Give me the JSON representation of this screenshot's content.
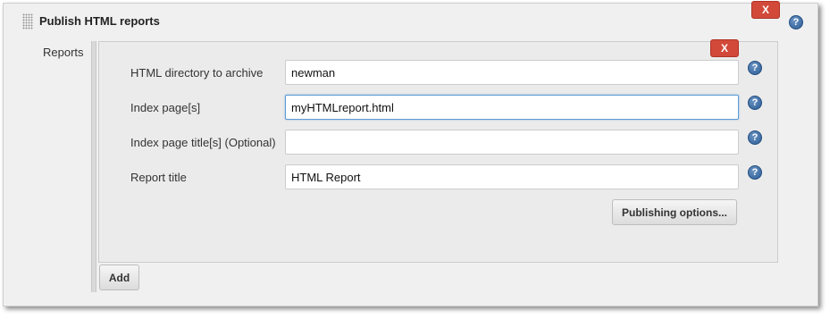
{
  "section": {
    "title": "Publish HTML reports",
    "delete_label": "X",
    "help_label": "?"
  },
  "reports": {
    "label": "Reports",
    "delete_label": "X",
    "fields": [
      {
        "label": "HTML directory to archive",
        "value": "newman",
        "help_label": "?"
      },
      {
        "label": "Index page[s]",
        "value": "myHTMLreport.html",
        "help_label": "?"
      },
      {
        "label": "Index page title[s] (Optional)",
        "value": "",
        "help_label": "?"
      },
      {
        "label": "Report title",
        "value": "HTML Report",
        "help_label": "?"
      }
    ],
    "publishing_options_label": "Publishing options...",
    "add_label": "Add"
  },
  "colors": {
    "delete_button": "#d24939",
    "help_icon": "#2a5b95",
    "focus_border": "#5b9bd5"
  },
  "icons": {
    "drag_handle": "drag-handle-icon",
    "help": "help-icon"
  }
}
